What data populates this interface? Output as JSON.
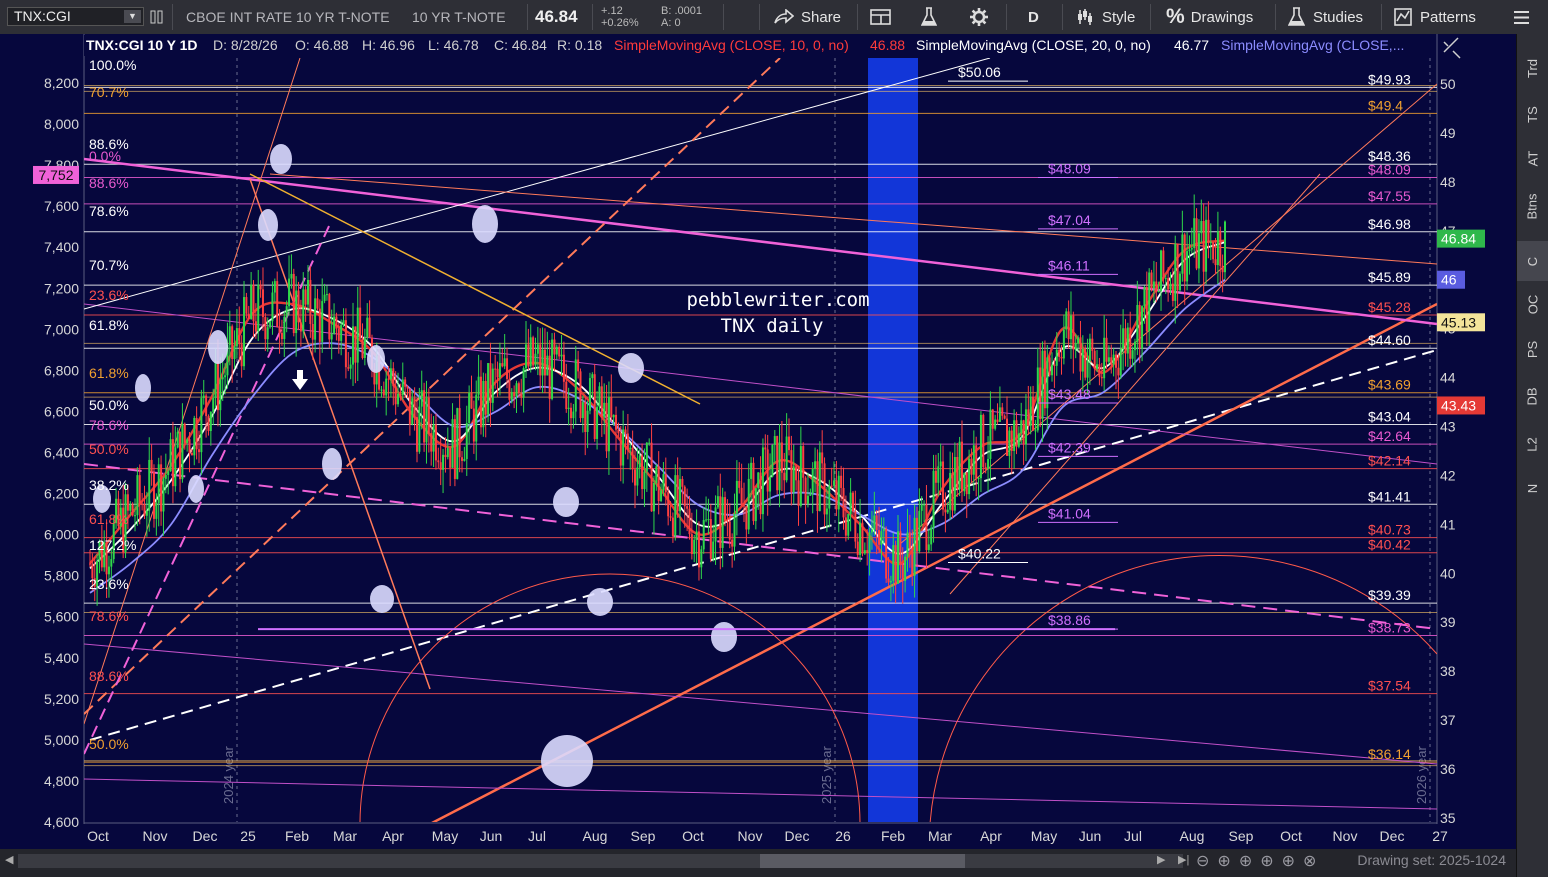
{
  "toolbar": {
    "symbol": "TNX:CGI",
    "desc1": "CBOE INT RATE 10 YR T-NOTE",
    "desc2": "10 YR T-NOTE",
    "last": "46.84",
    "change": "+.12",
    "change_pct": "+0.26%",
    "bid": "B: .0001",
    "ask": "A: 0",
    "share": "Share",
    "period": "D",
    "style": "Style",
    "drawings": "Drawings",
    "studies": "Studies",
    "patterns": "Patterns"
  },
  "sidebar": [
    "Trd",
    "TS",
    "AT",
    "Btns",
    "C",
    "OC",
    "PS",
    "DB",
    "L2",
    "N"
  ],
  "header": {
    "title": "TNX:CGI 10 Y 1D",
    "date": "D: 8/28/26",
    "open": "O: 46.88",
    "high": "H: 46.96",
    "low": "L: 46.78",
    "close": "C: 46.84",
    "range": "R: 0.18",
    "sma10": "SimpleMovingAvg (CLOSE, 10, 0, no)",
    "sma10_val": "46.88",
    "sma20": "SimpleMovingAvg (CLOSE, 20, 0, no)",
    "sma20_val": "46.77",
    "sma3": "SimpleMovingAvg (CLOSE,..."
  },
  "watermark": {
    "line1": "pebblewriter.com",
    "line2": "TNX daily"
  },
  "chart_data": {
    "type": "line",
    "title": "TNX:CGI 10 Y 1D",
    "left_axis": {
      "ticks": [
        "8,200",
        "8,000",
        "7,800",
        "7,600",
        "7,400",
        "7,200",
        "7,000",
        "6,800",
        "6,600",
        "6,400",
        "6,200",
        "6,000",
        "5,800",
        "5,600",
        "5,400",
        "5,200",
        "5,000",
        "4,800",
        "4,600"
      ],
      "ylim": [
        4600,
        8300
      ],
      "marker": "7,752"
    },
    "right_axis": {
      "ticks": [
        "50",
        "49",
        "48",
        "47",
        "46",
        "45",
        "44",
        "43",
        "42",
        "41",
        "40",
        "39",
        "38",
        "37",
        "36",
        "35"
      ],
      "ylim": [
        35,
        50.5
      ]
    },
    "x_labels": [
      "Oct",
      "Nov",
      "Dec",
      "25",
      "Feb",
      "Mar",
      "Apr",
      "May",
      "Jun",
      "Jul",
      "Aug",
      "Sep",
      "Oct",
      "Nov",
      "Dec",
      "26",
      "Feb",
      "Mar",
      "Apr",
      "May",
      "Jun",
      "Jul",
      "Aug",
      "Sep",
      "Oct",
      "Nov",
      "Dec",
      "27"
    ],
    "year_labels": [
      "2024 year",
      "2025 year",
      "2026 year"
    ],
    "price_tags": [
      {
        "label": "46.84",
        "value": 46.84,
        "color": "#2fb84b"
      },
      {
        "label": "46",
        "value": 46.0,
        "color": "#5a5ce0"
      },
      {
        "label": "45.13",
        "value": 45.13,
        "color": "#f3e49a"
      },
      {
        "label": "43.43",
        "value": 43.43,
        "color": "#e53935"
      }
    ],
    "horizontal_levels": [
      {
        "value": 49.93,
        "label": "$49.93",
        "color": "#ffffff"
      },
      {
        "value": 49.4,
        "label": "$49.4",
        "color": "#f0a030"
      },
      {
        "value": 48.36,
        "label": "$48.36",
        "color": "#ffffff"
      },
      {
        "value": 48.09,
        "label": "$48.09",
        "color": "#e85ad0"
      },
      {
        "value": 47.55,
        "label": "$47.55",
        "color": "#e85ad0"
      },
      {
        "value": 46.98,
        "label": "$46.98",
        "color": "#ffffff"
      },
      {
        "value": 45.89,
        "label": "$45.89",
        "color": "#ffffff"
      },
      {
        "value": 45.28,
        "label": "$45.28",
        "color": "#ff5050"
      },
      {
        "value": 44.6,
        "label": "$44.60",
        "color": "#ffffff"
      },
      {
        "value": 43.69,
        "label": "$43.69",
        "color": "#f0a030"
      },
      {
        "value": 43.04,
        "label": "$43.04",
        "color": "#ffffff"
      },
      {
        "value": 42.64,
        "label": "$42.64",
        "color": "#e85ad0"
      },
      {
        "value": 42.14,
        "label": "$42.14",
        "color": "#ff5050"
      },
      {
        "value": 41.41,
        "label": "$41.41",
        "color": "#ffffff"
      },
      {
        "value": 40.73,
        "label": "$40.73",
        "color": "#ff5050"
      },
      {
        "value": 40.42,
        "label": "$40.42",
        "color": "#ff5050"
      },
      {
        "value": 39.39,
        "label": "$39.39",
        "color": "#ffffff"
      },
      {
        "value": 38.73,
        "label": "$38.73",
        "color": "#e85ad0"
      },
      {
        "value": 37.54,
        "label": "$37.54",
        "color": "#ff5050"
      },
      {
        "value": 36.14,
        "label": "$36.14",
        "color": "#f0a030"
      }
    ],
    "fib_labels_left": [
      "100.0%",
      "70.7%",
      "88.6%",
      "0.0%",
      "88.6%",
      "78.6%",
      "70.7%",
      "23.6%",
      "61.8%",
      "61.8%",
      "50.0%",
      "78.6%",
      "50.0%",
      "38.2%",
      "61.8%",
      "127.2%",
      "23.6%",
      "78.6%",
      "88.6%",
      "50.0%"
    ],
    "mid_labels": [
      {
        "label": "$50.06",
        "value": 50.06
      },
      {
        "label": "$48.09",
        "value": 48.09
      },
      {
        "label": "$47.04",
        "value": 47.04
      },
      {
        "label": "$46.11",
        "value": 46.11
      },
      {
        "label": "$43.48",
        "value": 43.48
      },
      {
        "label": "$42.39",
        "value": 42.39
      },
      {
        "label": "$41.04",
        "value": 41.04
      },
      {
        "label": "$40.22",
        "value": 40.22
      },
      {
        "label": "$38.86",
        "value": 38.86
      }
    ],
    "series": [
      {
        "name": "SimpleMovingAvg (CLOSE, 10, 0, no)",
        "color": "#e53935",
        "values": [
          40.2,
          41.2,
          42.2,
          43.6,
          45.3,
          45.5,
          45.1,
          44.5,
          43.2,
          42.6,
          43.9,
          44.3,
          43.8,
          42.8,
          41.8,
          40.8,
          41.3,
          42.3,
          41.8,
          41.0,
          40.2,
          41.7,
          42.6,
          42.9,
          45.0,
          44.1,
          45.4,
          46.6,
          46.8
        ]
      },
      {
        "name": "SimpleMovingAvg (CLOSE, 20, 0, no)",
        "color": "#ffffff",
        "values": [
          40.1,
          40.9,
          41.9,
          43.2,
          44.8,
          45.4,
          45.2,
          44.6,
          43.4,
          42.7,
          43.7,
          44.2,
          43.9,
          43.0,
          42.0,
          41.0,
          41.2,
          42.1,
          41.9,
          41.2,
          40.4,
          41.4,
          42.4,
          42.8,
          44.6,
          44.2,
          45.2,
          46.4,
          46.77
        ]
      },
      {
        "name": "SimpleMovingAvg (CLOSE,...",
        "color": "#8c8cff",
        "values": [
          39.6,
          40.2,
          41.0,
          42.4,
          43.6,
          44.5,
          44.7,
          44.4,
          43.7,
          43.0,
          43.3,
          43.8,
          43.6,
          43.0,
          42.2,
          41.4,
          41.2,
          41.6,
          41.6,
          41.2,
          40.8,
          41.0,
          41.6,
          42.1,
          43.4,
          43.7,
          44.5,
          45.4,
          46.0
        ]
      }
    ]
  },
  "bottom": {
    "drawing_set": "Drawing set: 2025-1024"
  }
}
